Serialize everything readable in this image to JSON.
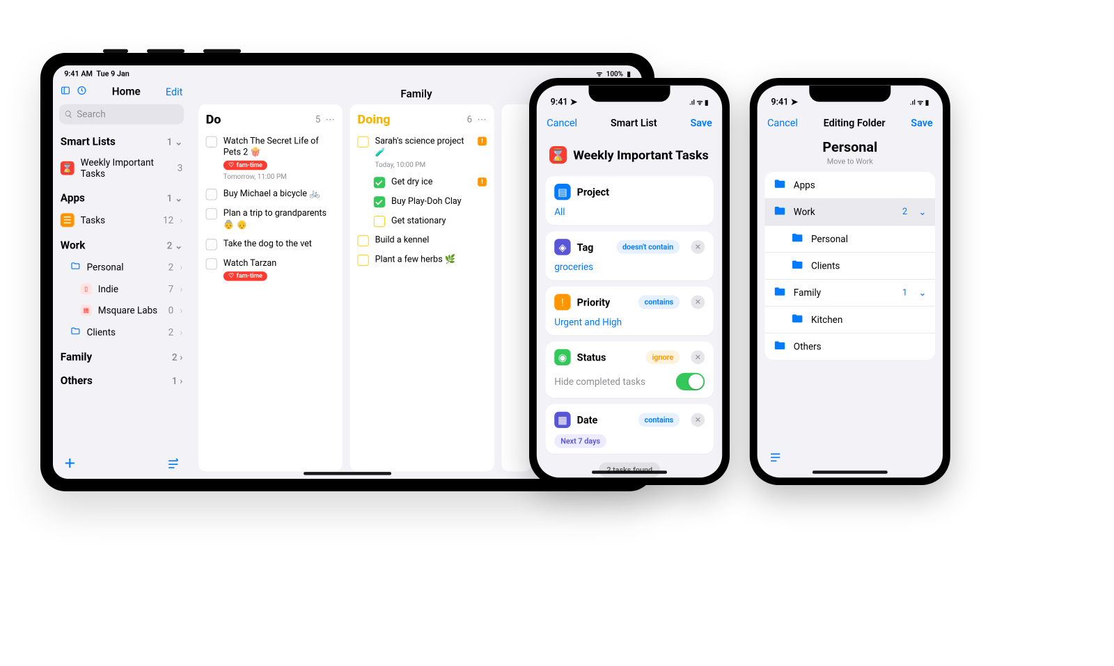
{
  "ipad": {
    "statusbar": {
      "time": "9:41 AM",
      "date": "Tue 9 Jan",
      "battery": "100%"
    },
    "sidebar": {
      "title": "Home",
      "edit": "Edit",
      "search_placeholder": "Search",
      "sections": {
        "smart_lists": {
          "header": "Smart Lists",
          "count": "1",
          "items": [
            {
              "label": "Weekly Important Tasks",
              "count": "3",
              "color": "#ff3b30",
              "glyph": "⌛"
            }
          ]
        },
        "apps": {
          "header": "Apps",
          "count": "1",
          "items": [
            {
              "label": "Tasks",
              "count": "12",
              "color": "#ff9500",
              "glyph": "☰"
            }
          ]
        },
        "work": {
          "header": "Work",
          "count": "2",
          "items": [
            {
              "label": "Personal",
              "count": "2",
              "color": "#007aff",
              "kind": "folder"
            },
            {
              "label": "Indie",
              "count": "7",
              "color": "#ff3b30",
              "glyph": "▯",
              "indent": 2
            },
            {
              "label": "Msquare Labs",
              "count": "0",
              "color": "#ff3b30",
              "glyph": "▦",
              "indent": 2
            },
            {
              "label": "Clients",
              "count": "2",
              "color": "#007aff",
              "kind": "folder"
            }
          ]
        },
        "family": {
          "header": "Family",
          "count": "2"
        },
        "others": {
          "header": "Others",
          "count": "1"
        }
      }
    },
    "board": {
      "title": "Family",
      "columns": [
        {
          "name": "Do",
          "count": "5",
          "color": "#000",
          "tasks": [
            {
              "title": "Watch The Secret Life of Pets 2 🍿",
              "tag": "fam-time",
              "sub": "Tomorrow, 11:00 PM"
            },
            {
              "title": "Buy Michael a bicycle 🚲"
            },
            {
              "title": "Plan a trip to grandparents 👵 👴"
            },
            {
              "title": "Take the dog to the vet"
            },
            {
              "title": "Watch Tarzan",
              "tag": "fam-time"
            }
          ]
        },
        {
          "name": "Doing",
          "count": "6",
          "color": "#ffcc00",
          "tasks": [
            {
              "title": "Sarah's science project 🧪",
              "sub": "Today, 10:00 PM",
              "flag": true,
              "yellow": true,
              "children": [
                {
                  "title": "Get dry ice",
                  "done": true,
                  "flag": true
                },
                {
                  "title": "Buy Play-Doh Clay",
                  "done": true
                },
                {
                  "title": "Get stationary",
                  "yellow": true
                }
              ]
            },
            {
              "title": "Build a kennel",
              "yellow": true
            },
            {
              "title": "Plant a few herbs 🌿",
              "yellow": true
            }
          ]
        }
      ]
    }
  },
  "phone1": {
    "statusbar": {
      "time": "9:41"
    },
    "nav": {
      "cancel": "Cancel",
      "title": "Smart List",
      "save": "Save"
    },
    "list_title": "Weekly Important Tasks",
    "icon_color": "#ff3b30",
    "cards": {
      "project": {
        "label": "Project",
        "icon_color": "#007aff",
        "value": "All"
      },
      "tag": {
        "label": "Tag",
        "icon_color": "#5856d6",
        "pill": "doesn't contain",
        "pill_style": "blue",
        "value": "groceries"
      },
      "priority": {
        "label": "Priority",
        "icon_color": "#ff9500",
        "pill": "contains",
        "pill_style": "blue",
        "value": "Urgent and High"
      },
      "status": {
        "label": "Status",
        "icon_color": "#34c759",
        "pill": "ignore",
        "pill_style": "orange",
        "toggle_label": "Hide completed tasks"
      },
      "date": {
        "label": "Date",
        "icon_color": "#5856d6",
        "pill": "contains",
        "pill_style": "blue",
        "chip": "Next 7 days"
      }
    },
    "found": "2 tasks found"
  },
  "phone2": {
    "statusbar": {
      "time": "9:41"
    },
    "nav": {
      "cancel": "Cancel",
      "title": "Editing Folder",
      "save": "Save"
    },
    "folder_title": "Personal",
    "subtitle": "Move to Work",
    "rows": [
      {
        "label": "Apps",
        "color": "#007aff"
      },
      {
        "label": "Work",
        "color": "#007aff",
        "count": "2",
        "expand": true,
        "selected": true
      },
      {
        "label": "Personal",
        "color": "#007aff",
        "indent": true
      },
      {
        "label": "Clients",
        "color": "#007aff",
        "indent": true
      },
      {
        "label": "Family",
        "color": "#007aff",
        "count": "1",
        "expand": true
      },
      {
        "label": "Kitchen",
        "color": "#007aff",
        "indent": true
      },
      {
        "label": "Others",
        "color": "#007aff"
      }
    ]
  }
}
